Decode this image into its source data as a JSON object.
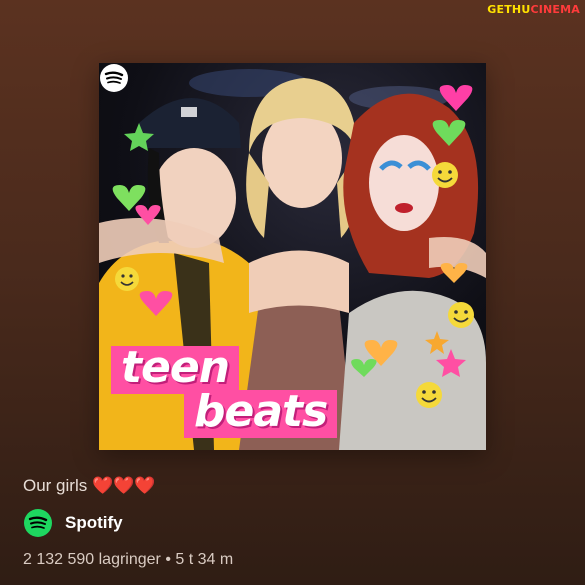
{
  "watermark": {
    "part1": "GETHU",
    "part2": "CINEMA"
  },
  "cover": {
    "title_line1": "teen",
    "title_line2": "beats",
    "badge_icon": "spotify-logo-icon",
    "accent_color": "#ff4fa3"
  },
  "playlist": {
    "caption": "Our girls ❤️❤️❤️",
    "owner": "Spotify",
    "owner_icon": "spotify-logo-icon",
    "meta": "2 132 590 lagringer • 5 t 34 m"
  },
  "colors": {
    "background_top": "#5b3220",
    "background_bottom": "#2f1d14",
    "spotify_green": "#1ed760"
  }
}
